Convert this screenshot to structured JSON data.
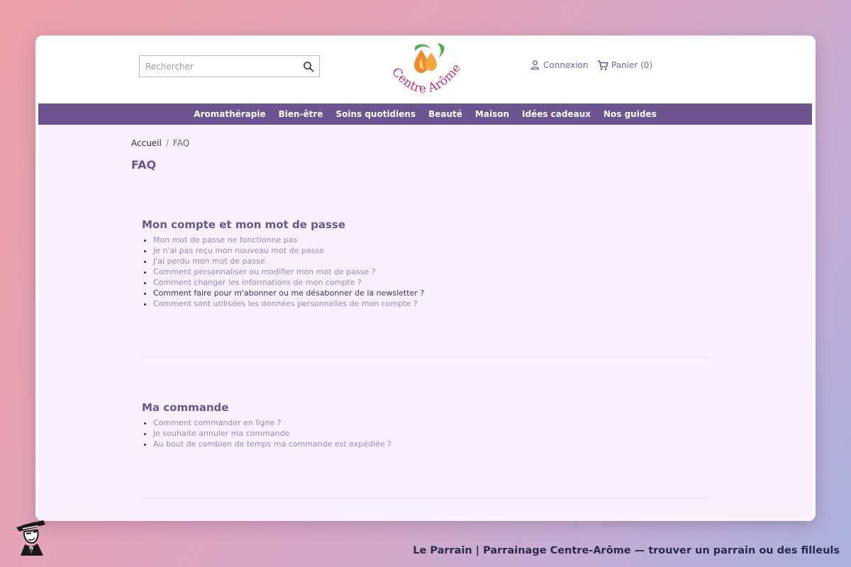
{
  "header": {
    "search": {
      "placeholder": "Rechercher",
      "icon": "search-icon"
    },
    "logo": {
      "text": "Centre Arôme",
      "colors": {
        "text": "#c0357f",
        "drop": "#f08a2c",
        "leaf": "#4fb14e"
      }
    },
    "account": {
      "label": "Connexion",
      "icon": "user-icon"
    },
    "cart": {
      "label": "Panier (0)",
      "icon": "cart-icon"
    }
  },
  "nav": {
    "items": [
      "Aromathérapie",
      "Bien-être",
      "Soins quotidiens",
      "Beauté",
      "Maison",
      "Idées cadeaux",
      "Nos guides"
    ]
  },
  "breadcrumb": {
    "home": "Accueil",
    "separator": "/",
    "current": "FAQ"
  },
  "page_title": "FAQ",
  "sections": [
    {
      "title": "Mon compte et mon mot de passe",
      "items": [
        "Mon mot de passe ne fonctionne pas",
        "Je n'ai pas reçu mon nouveau mot de passe",
        "J'ai perdu mon mot de passe",
        "Comment personnaliser ou modifier mon mot de passe ?",
        "Comment changer les informations de mon compte ?",
        "Comment faire pour m'abonner ou me désabonner de la newsletter ?",
        "Comment sont utilisées les données personnelles de mon compte ?"
      ]
    },
    {
      "title": "Ma commande",
      "items": [
        "Comment commander en ligne ?",
        "Je souhaite annuler ma commande",
        "Au bout de combien de temps ma commande est expédiée ?"
      ]
    }
  ],
  "footer": {
    "caption": "Le Parrain | Parrainage Centre-Arôme — trouver un parrain ou des filleuls"
  },
  "colors": {
    "accent": "#6d5490",
    "link": "#9b86be",
    "content_bg": "#fbf0fd",
    "nav_text": "#ffffff"
  }
}
